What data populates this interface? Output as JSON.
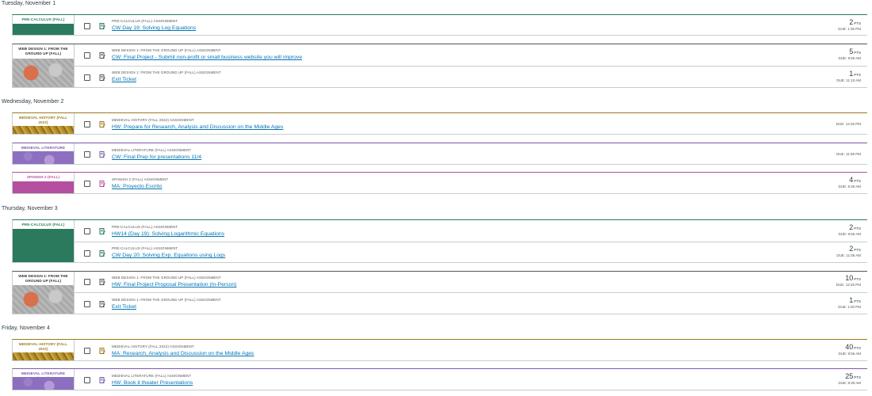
{
  "days": [
    {
      "date": "Tuesday, November 1",
      "courses": [
        {
          "name": "PRE-CALCULUS (FALL)",
          "items": [
            {
              "type": "PRE-CALCULUS (FALL) ASSIGNMENT",
              "title": "CW Day 19: Solving Log Equations",
              "pts": "2",
              "pts_unit": "PTS",
              "due": "DUE: 1:35 PM"
            }
          ]
        },
        {
          "name": "WEB DESIGN 1: FROM THE GROUND UP (FALL)",
          "items": [
            {
              "type": "WEB DESIGN 1: FROM THE GROUND UP (FALL) ASSIGNMENT",
              "title": "CW: Final Project - Submit non-profit or small business website you will improve",
              "pts": "5",
              "pts_unit": "PTS",
              "due": "DUE: 9:50 AM"
            },
            {
              "type": "WEB DESIGN 1: FROM THE GROUND UP (FALL) ASSIGNMENT",
              "title": "Exit Ticket",
              "pts": "1",
              "pts_unit": "PTS",
              "due": "DUE: 11:10 AM"
            }
          ]
        }
      ]
    },
    {
      "date": "Wednesday, November 2",
      "courses": [
        {
          "name": "MEDIEVAL HISTORY (FALL 2022)",
          "items": [
            {
              "type": "MEDIEVAL HISTORY (FALL 2022) ASSIGNMENT",
              "title": "HW: Prepare for Research, Analysis and Discussion on the Middle Ages",
              "pts": "",
              "pts_unit": "",
              "due": "DUE: 12:25 PM"
            }
          ]
        },
        {
          "name": "MEDIEVAL LITERATURE (FALL)",
          "items": [
            {
              "type": "MEDIEVAL LITERATURE (FALL) ASSIGNMENT",
              "title": "CW: Final Prep for presentations 11/4",
              "pts": "",
              "pts_unit": "",
              "due": "DUE: 11:59 PM"
            }
          ]
        },
        {
          "name": "SPANISH 2 (FALL)",
          "items": [
            {
              "type": "SPANISH 2 (FALL) ASSIGNMENT",
              "title": "MA: Proyecto Escrito",
              "pts": "4",
              "pts_unit": "PTS",
              "due": "DUE: 8:30 AM"
            }
          ]
        }
      ]
    },
    {
      "date": "Thursday, November 3",
      "courses": [
        {
          "name": "PRE-CALCULUS (FALL)",
          "items": [
            {
              "type": "PRE-CALCULUS (FALL) ASSIGNMENT",
              "title": "HW14 (Day 19): Solving Logarithmic Equations",
              "pts": "2",
              "pts_unit": "PTS",
              "due": "DUE: 9:55 AM"
            },
            {
              "type": "PRE-CALCULUS (FALL) ASSIGNMENT",
              "title": "CW Day 20: Solving Exp. Equations using Logs",
              "pts": "2",
              "pts_unit": "PTS",
              "due": "DUE: 11:05 AM"
            }
          ]
        },
        {
          "name": "WEB DESIGN 1: FROM THE GROUND UP (FALL)",
          "items": [
            {
              "type": "WEB DESIGN 1: FROM THE GROUND UP (FALL) ASSIGNMENT",
              "title": "HW: Final Project Proposal Presentation (In-Person)",
              "pts": "10",
              "pts_unit": "PTS",
              "due": "DUE: 12:25 PM"
            },
            {
              "type": "WEB DESIGN 1: FROM THE GROUND UP (FALL) ASSIGNMENT",
              "title": "Exit Ticket",
              "pts": "1",
              "pts_unit": "PTS",
              "due": "DUE: 1:00 PM"
            }
          ]
        }
      ]
    },
    {
      "date": "Friday, November 4",
      "courses": [
        {
          "name": "MEDIEVAL HISTORY (FALL 2022)",
          "items": [
            {
              "type": "MEDIEVAL HISTORY (FALL 2022) ASSIGNMENT",
              "title": "MA: Research, Analysis and Discussion on the Middle Ages",
              "pts": "40",
              "pts_unit": "PTS",
              "due": "DUE: 9:55 AM"
            }
          ]
        },
        {
          "name": "MEDIEVAL LITERATURE (FALL)",
          "items": [
            {
              "type": "MEDIEVAL LITERATURE (FALL) ASSIGNMENT",
              "title": "HW: Book it theater Presentations",
              "pts": "25",
              "pts_unit": "PTS",
              "due": "DUE: 8:30 AM"
            }
          ]
        }
      ]
    }
  ],
  "colors": {
    "precalc": "#2b7a5d",
    "webdesign": "#555555",
    "medhist": "#9a7a1e",
    "medlit": "#7a5aa8",
    "spanish": "#b54fa0",
    "link": "#0374b5"
  },
  "icons": {
    "checkbox": "checkbox-icon",
    "assignment": "assignment-icon"
  }
}
